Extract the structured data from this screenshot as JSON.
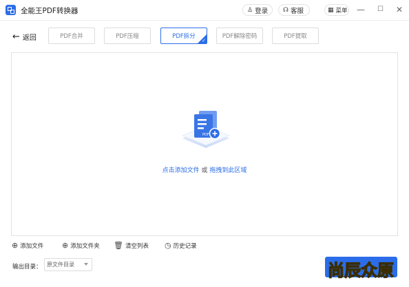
{
  "window": {
    "title": "全能王PDF转换器",
    "login_label": "登录",
    "service_label": "客服",
    "menu_label": "菜单",
    "min_glyph": "—",
    "max_glyph": "☐",
    "close_glyph": "✕"
  },
  "toolbar": {
    "back_label": "返回",
    "tabs": [
      {
        "label": "PDF合并",
        "active": false
      },
      {
        "label": "PDF压缩",
        "active": false
      },
      {
        "label": "PDF拆分",
        "active": true
      },
      {
        "label": "PDF解除密码",
        "active": false
      },
      {
        "label": "PDF提取",
        "active": false
      }
    ]
  },
  "dropzone": {
    "add_link": "点击添加文件",
    "or_text": " 或 ",
    "drag_link": "拖拽到此区域"
  },
  "actions": {
    "add_file": "添加文件",
    "add_folder": "添加文件夹",
    "clear_list": "清空列表",
    "history": "历史记录"
  },
  "output": {
    "label": "输出目录：",
    "selected": "原文件目录"
  },
  "start_button": "",
  "watermark": "尚辰众原",
  "colors": {
    "accent": "#2b6de8",
    "watermark": "#f4c51b"
  }
}
